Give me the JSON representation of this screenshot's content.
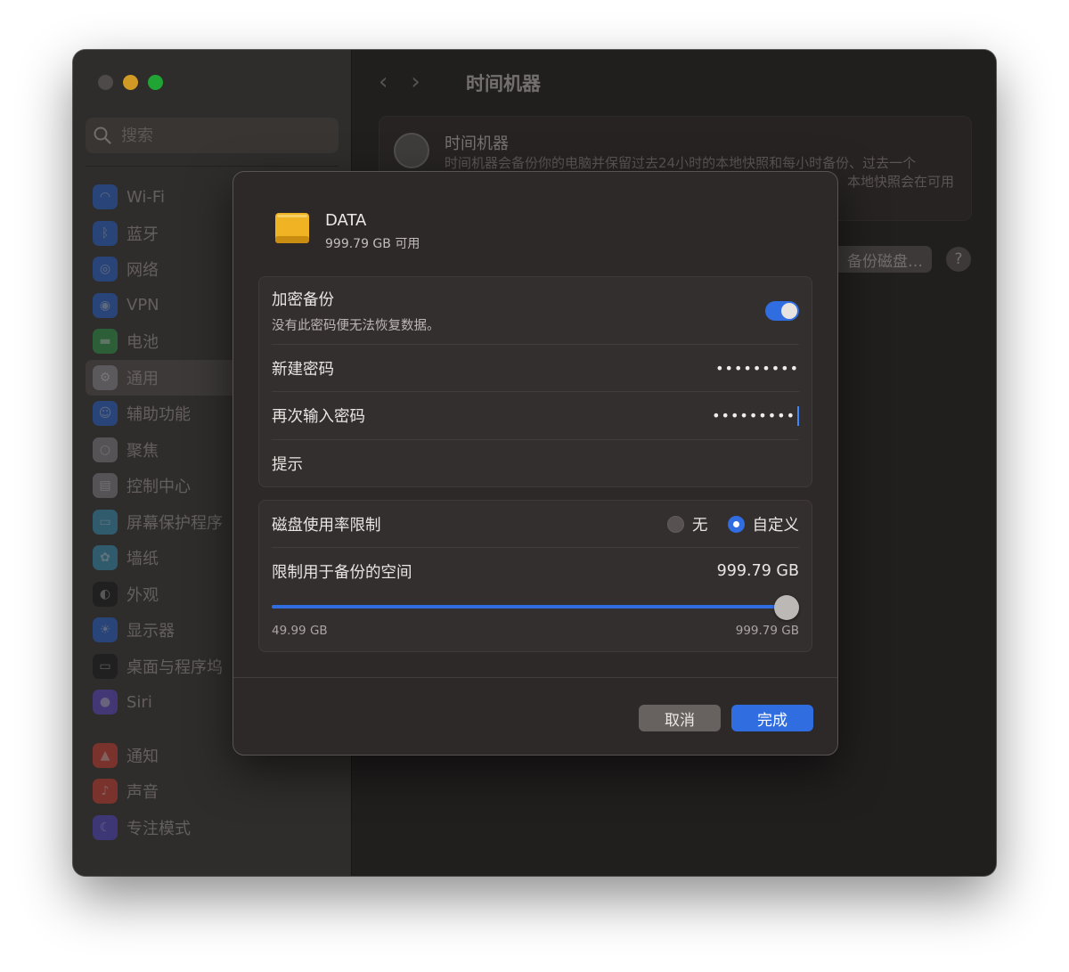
{
  "window": {
    "controls": [
      "close",
      "minimize",
      "zoom"
    ]
  },
  "sidebar": {
    "search_placeholder": "搜索",
    "items": [
      {
        "label": "Wi-Fi",
        "icon": "wifi-icon",
        "color": "#2f6de0"
      },
      {
        "label": "蓝牙",
        "icon": "bluetooth-icon",
        "color": "#2f6de0"
      },
      {
        "label": "网络",
        "icon": "globe-icon",
        "color": "#2f6de0"
      },
      {
        "label": "VPN",
        "icon": "vpn-icon",
        "color": "#2f6de0"
      },
      {
        "label": "电池",
        "icon": "battery-icon",
        "color": "#34a853"
      },
      {
        "label": "通用",
        "icon": "gear-icon",
        "color": "#8e8e93",
        "active": true
      },
      {
        "label": "辅助功能",
        "icon": "accessibility-icon",
        "color": "#2f6de0"
      },
      {
        "label": "聚焦",
        "icon": "spotlight-icon",
        "color": "#8e8e93"
      },
      {
        "label": "控制中心",
        "icon": "control-center-icon",
        "color": "#8e8e93"
      },
      {
        "label": "屏幕保护程序",
        "icon": "screensaver-icon",
        "color": "#3aa0c8"
      },
      {
        "label": "墙纸",
        "icon": "wallpaper-icon",
        "color": "#3aa0c8"
      },
      {
        "label": "外观",
        "icon": "appearance-icon",
        "color": "#1c1c1e"
      },
      {
        "label": "显示器",
        "icon": "display-icon",
        "color": "#2f6de0"
      },
      {
        "label": "桌面与程序坞",
        "icon": "dock-icon",
        "color": "#1c1c1e"
      },
      {
        "label": "Siri",
        "icon": "siri-icon",
        "color": "#6a4fd8"
      },
      {
        "label": "通知",
        "icon": "bell-icon",
        "color": "#e0443a",
        "group_start": true
      },
      {
        "label": "声音",
        "icon": "sound-icon",
        "color": "#e0443a"
      },
      {
        "label": "专注模式",
        "icon": "moon-icon",
        "color": "#5b4fd8"
      }
    ]
  },
  "main": {
    "back_icon": "chevron-left-icon",
    "forward_icon": "chevron-right-icon",
    "title": "时间机器",
    "card_title": "时间机器",
    "card_desc": "时间机器会备份你的电脑并保留过去24小时的本地快照和每小时备份、过去一个",
    "card_desc_2": "本地快照会在可用",
    "add_disk_label": "备份磁盘…",
    "help_label": "?"
  },
  "sheet": {
    "disk_name": "DATA",
    "disk_free": "999.79 GB 可用",
    "encrypt": {
      "label": "加密备份",
      "desc": "没有此密码便无法恢复数据。",
      "on": true
    },
    "new_password": {
      "label": "新建密码",
      "value": "•••••••••"
    },
    "confirm_password": {
      "label": "再次输入密码",
      "value": "•••••••••"
    },
    "hint": {
      "label": "提示",
      "value": ""
    },
    "disk_limit": {
      "label": "磁盘使用率限制",
      "option_none": "无",
      "option_custom": "自定义",
      "selected": "custom"
    },
    "space_limit": {
      "label": "限制用于备份的空间",
      "value": "999.79 GB",
      "min_label": "49.99 GB",
      "max_label": "999.79 GB",
      "min": 49.99,
      "max": 999.79,
      "current": 999.79
    },
    "cancel_label": "取消",
    "done_label": "完成"
  },
  "colors": {
    "accent": "#2f6de0",
    "disk": "#f0b323"
  }
}
